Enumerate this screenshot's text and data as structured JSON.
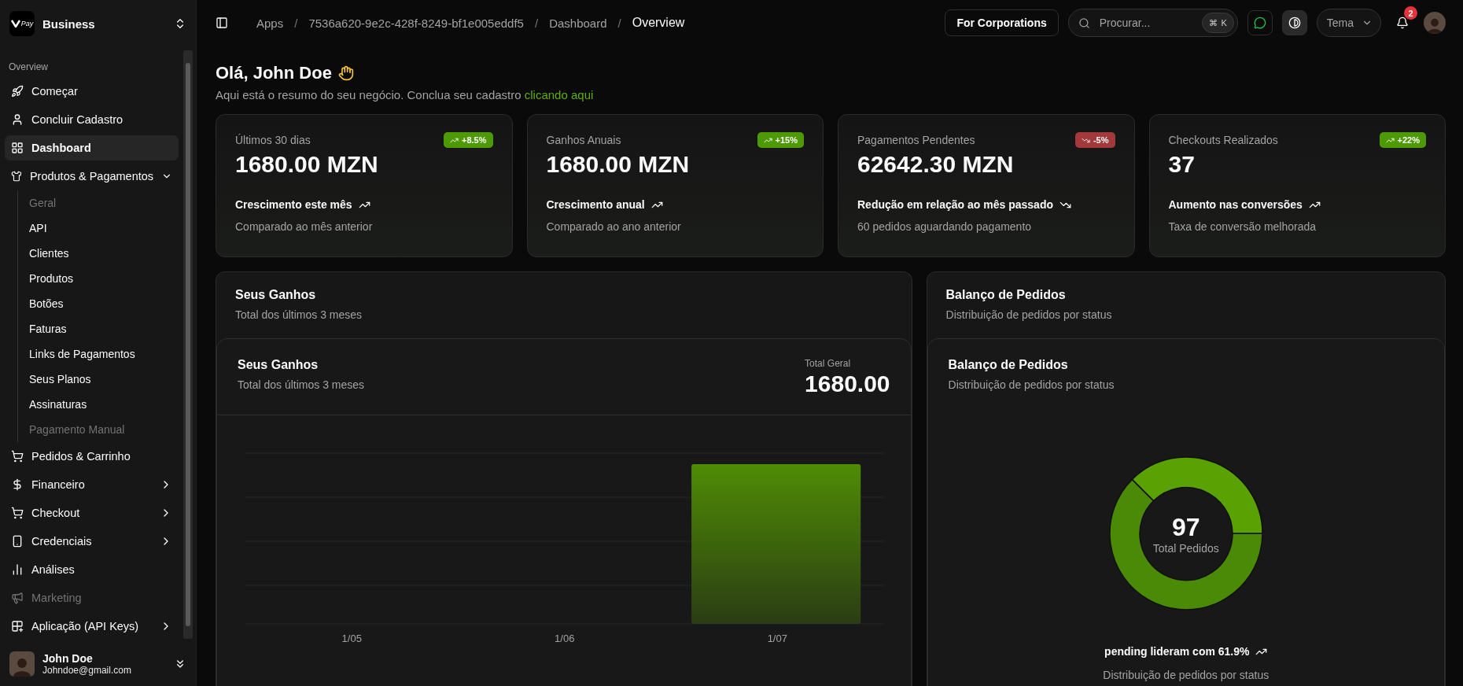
{
  "sidebar": {
    "logo_text": "Pay",
    "workspace": "Business",
    "nav": [
      {
        "kind": "section",
        "label": "Overview"
      },
      {
        "kind": "item",
        "label": "Começar",
        "selected": false,
        "disabled": false
      },
      {
        "kind": "item",
        "label": "Concluir Cadastro",
        "selected": false,
        "disabled": false
      },
      {
        "kind": "item",
        "label": "Dashboard",
        "selected": true,
        "disabled": false
      },
      {
        "kind": "group",
        "label": "Produtos & Pagamentos",
        "selected": false,
        "disabled": false,
        "expanded": true,
        "children": [
          {
            "label": "Geral",
            "selected": false,
            "disabled": true
          },
          {
            "label": "API",
            "selected": false,
            "disabled": false
          },
          {
            "label": "Clientes",
            "selected": false,
            "disabled": false
          },
          {
            "label": "Produtos",
            "selected": false,
            "disabled": false
          },
          {
            "label": "Botões",
            "selected": false,
            "disabled": false
          },
          {
            "label": "Faturas",
            "selected": false,
            "disabled": false
          },
          {
            "label": "Links de Pagamentos",
            "selected": false,
            "disabled": false
          },
          {
            "label": "Seus Planos",
            "selected": false,
            "disabled": false
          },
          {
            "label": "Assinaturas",
            "selected": false,
            "disabled": false
          },
          {
            "label": "Pagamento Manual",
            "selected": false,
            "disabled": true
          }
        ]
      },
      {
        "kind": "item",
        "label": "Pedidos & Carrinho",
        "selected": false,
        "disabled": false
      },
      {
        "kind": "group",
        "label": "Financeiro",
        "selected": false,
        "disabled": false,
        "expanded": false
      },
      {
        "kind": "group",
        "label": "Checkout",
        "selected": false,
        "disabled": false,
        "expanded": false
      },
      {
        "kind": "group",
        "label": "Credenciais",
        "selected": false,
        "disabled": false,
        "expanded": false
      },
      {
        "kind": "item",
        "label": "Análises",
        "selected": false,
        "disabled": false
      },
      {
        "kind": "item",
        "label": "Marketing",
        "selected": false,
        "disabled": true
      },
      {
        "kind": "group",
        "label": "Aplicação (API Keys)",
        "selected": false,
        "disabled": false,
        "expanded": false
      }
    ],
    "user": {
      "name": "John Doe",
      "email": "Johndoe@gmail.com"
    }
  },
  "header": {
    "breadcrumbs": [
      {
        "label": "Apps",
        "current": false
      },
      {
        "label": "7536a620-9e2c-428f-8249-bf1e005eddf5",
        "current": false
      },
      {
        "label": "Dashboard",
        "current": false
      },
      {
        "label": "Overview",
        "current": true
      }
    ],
    "separators": [
      "/",
      "/",
      "/"
    ],
    "corporate_button": "For Corporations",
    "search": {
      "placeholder": "Procurar...",
      "shortcut": [
        "⌘",
        "K"
      ]
    },
    "theme_select": "Tema",
    "notifications": "2"
  },
  "greeting": {
    "title": "Olá, John Doe",
    "subtitle": "Aqui está o resumo do seu negócio. Conclua seu cadastro",
    "link": "clicando aqui"
  },
  "stats": [
    {
      "label": "Últimos 30 dias",
      "badge": "+8.5%",
      "kind": "up",
      "value": "1680.00 MZN",
      "note": "Crescimento este mês",
      "caption": "Comparado ao mês anterior"
    },
    {
      "label": "Ganhos Anuais",
      "badge": "+15%",
      "kind": "up",
      "value": "1680.00 MZN",
      "note": "Crescimento anual",
      "caption": "Comparado ao ano anterior"
    },
    {
      "label": "Pagamentos Pendentes",
      "badge": "-5%",
      "kind": "down",
      "value": "62642.30 MZN",
      "note": "Redução em relação ao mês passado",
      "caption": "60 pedidos aguardando pagamento"
    },
    {
      "label": "Checkouts Realizados",
      "badge": "+22%",
      "kind": "up",
      "value": "37",
      "note": "Aumento nas conversões",
      "caption": "Taxa de conversão melhorada"
    }
  ],
  "earnings": {
    "title": "Seus Ganhos",
    "subtitle": "Total dos últimos 3 meses",
    "inner_title": "Seus Ganhos",
    "inner_subtitle": "Total dos últimos 3 meses",
    "total_label": "Total Geral",
    "total": "1680.00",
    "x_labels": [
      "1/05",
      "1/06",
      "1/07"
    ]
  },
  "orders": {
    "title": "Balanço de Pedidos",
    "subtitle": "Distribuição de pedidos por status",
    "inner_title": "Balanço de Pedidos",
    "inner_subtitle": "Distribuição de pedidos por status",
    "center_value": "97",
    "center_label": "Total Pedidos",
    "footer": "pending lideram com 61.9%",
    "footer_caption": "Distribuição de pedidos por status"
  }
}
